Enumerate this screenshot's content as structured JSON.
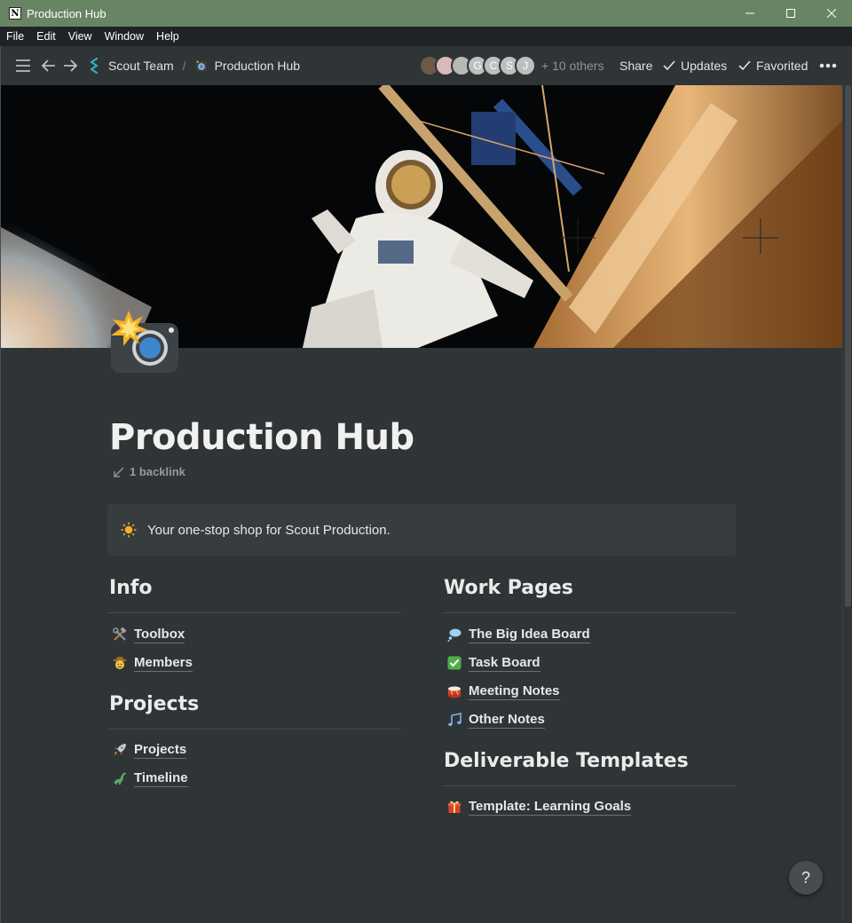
{
  "window": {
    "title": "Production Hub"
  },
  "menu": [
    "File",
    "Edit",
    "View",
    "Window",
    "Help"
  ],
  "breadcrumb": {
    "workspace": "Scout Team",
    "separator": "/",
    "page": "Production Hub"
  },
  "avatars": [
    "",
    "",
    "",
    "G",
    "C",
    "S",
    "J"
  ],
  "others": "+ 10 others",
  "actions": {
    "share": "Share",
    "updates": "Updates",
    "favorited": "Favorited"
  },
  "page": {
    "title": "Production Hub",
    "backlink": "1 backlink",
    "callout": "Your one-stop shop for Scout Production."
  },
  "sections": {
    "info": {
      "heading": "Info",
      "links": [
        {
          "label": "Toolbox",
          "icon": "hammer-wrench-icon"
        },
        {
          "label": "Members",
          "icon": "cowboy-face-icon"
        }
      ]
    },
    "projects": {
      "heading": "Projects",
      "links": [
        {
          "label": "Projects",
          "icon": "rocket-icon"
        },
        {
          "label": "Timeline",
          "icon": "dinosaur-icon"
        }
      ]
    },
    "work_pages": {
      "heading": "Work Pages",
      "links": [
        {
          "label": "The Big Idea Board",
          "icon": "thought-bubble-icon"
        },
        {
          "label": "Task Board",
          "icon": "check-box-icon"
        },
        {
          "label": "Meeting Notes",
          "icon": "drum-icon"
        },
        {
          "label": "Other Notes",
          "icon": "music-notes-icon"
        }
      ]
    },
    "templates": {
      "heading": "Deliverable Templates",
      "links": [
        {
          "label": "Template: Learning Goals",
          "icon": "gift-icon"
        }
      ]
    }
  },
  "help": "?",
  "colors": {
    "titlebar": "#698465",
    "background": "#2f3437",
    "callout": "#373c3f"
  }
}
